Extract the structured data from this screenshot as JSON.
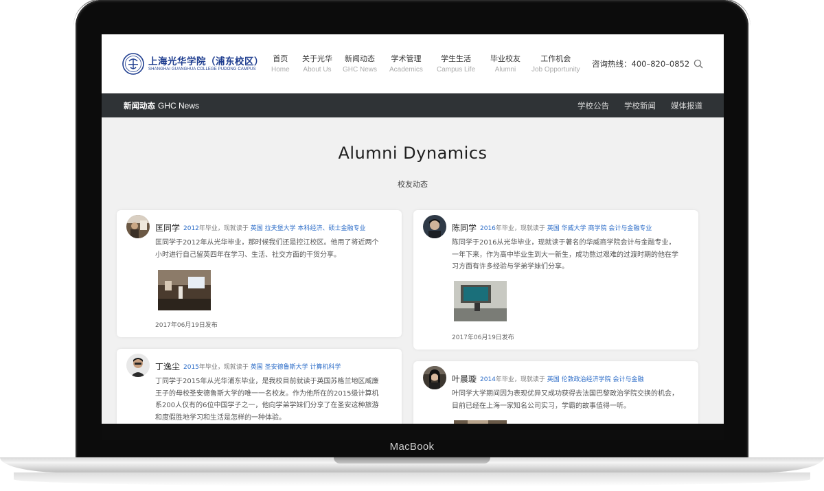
{
  "device": {
    "label": "MacBook"
  },
  "header": {
    "logo_cn": "上海光华学院（浦东校区）",
    "logo_en": "SHANGHAI GUANGHUA COLLEGE PUDONG CAMPUS",
    "nav": [
      {
        "cn": "首页",
        "en": "Home"
      },
      {
        "cn": "关于光华",
        "en": "About Us"
      },
      {
        "cn": "新闻动态",
        "en": "GHC News"
      },
      {
        "cn": "学术管理",
        "en": "Academics"
      },
      {
        "cn": "学生生活",
        "en": "Campus Life"
      },
      {
        "cn": "毕业校友",
        "en": "Alumni"
      },
      {
        "cn": "工作机会",
        "en": "Job Opportunity"
      }
    ],
    "hotline": "咨询热线：400–820–0852",
    "search_icon": "search-icon"
  },
  "subbar": {
    "title_cn": "新闻动态",
    "title_en": "GHC News",
    "links": [
      "学校公告",
      "学校新闻",
      "媒体报道"
    ]
  },
  "section": {
    "title": "Alumni Dynamics",
    "subtitle": "校友动态"
  },
  "cards": [
    {
      "name": "匡同学",
      "year": "2012",
      "grad_text": "年毕业，现就读于",
      "school": "英国 拉夫堡大学 本科经济、硕士金融专业",
      "desc": "匡同学于2012年从光华毕业，那时候我们还是控江校区。他用了将近两个小时进行自己留英四年在学习、生活、社交方面的干货分享。",
      "date": "2017年06月19日发布"
    },
    {
      "name": "陈同学",
      "year": "2016",
      "grad_text": "年毕业，现就读于",
      "school": "英国 华威大学 商学院 会计与金融专业",
      "desc": "陈同学于2016从光华毕业，现就读于著名的华威商学院会计与金融专业，一年下来，作为高中毕业生到大一新生，成功熬过艰难的过渡时期的他在学习方面有许多经验与学弟学妹们分享。",
      "date": "2017年06月19日发布"
    },
    {
      "name": "丁逸尘",
      "year": "2015",
      "grad_text": "年毕业，现就读于",
      "school": "英国 圣安德鲁斯大学 计算机科学",
      "desc": "丁同学于2015年从光华浦东毕业，是我校目前就读于英国苏格兰地区威廉王子的母校圣安德鲁斯大学的唯一一名校友。作为他所在的2015级计算机系200人仅有的6位中国学子之一，他向学弟学妹们分享了在圣安这种旅游和度假胜地学习和生活是怎样的一种体验。"
    },
    {
      "name": "叶晨璇",
      "year": "2014",
      "grad_text": "年毕业，现就读于",
      "school": "英国 伦敦政治经济学院 会计与金融",
      "desc": "叶同学大学期间因为表现优异又成功获得去法国巴黎政治学院交换的机会，目前已经在上海一家知名公司实习，学霸的故事值得一听。"
    }
  ]
}
